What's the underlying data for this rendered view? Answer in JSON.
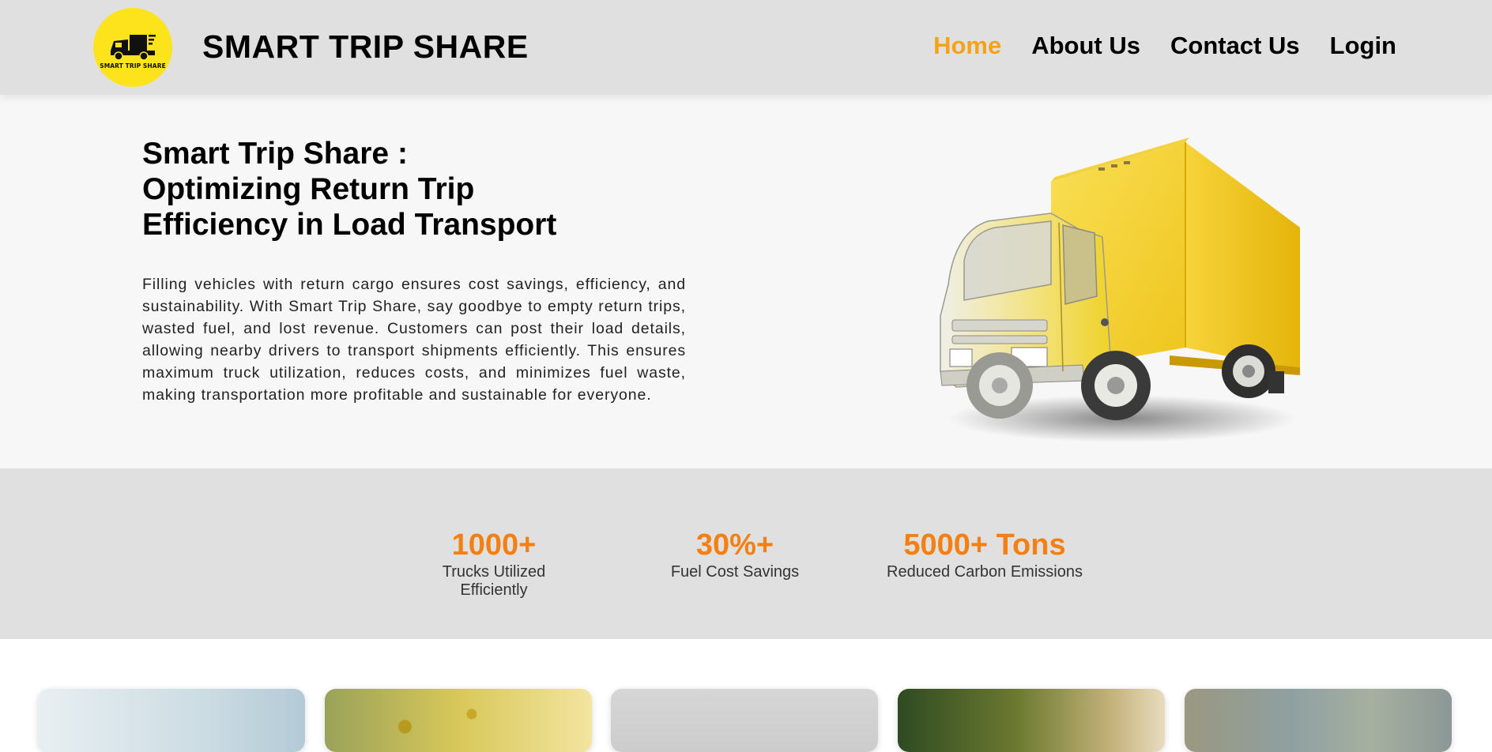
{
  "header": {
    "logo_text": "SMART TRIP SHARE",
    "brand": "SMART TRIP SHARE",
    "nav": [
      {
        "label": "Home",
        "active": true
      },
      {
        "label": "About Us",
        "active": false
      },
      {
        "label": "Contact Us",
        "active": false
      },
      {
        "label": "Login",
        "active": false
      }
    ]
  },
  "hero": {
    "title_lines": [
      "Smart Trip Share :",
      "Optimizing Return Trip",
      "Efficiency in Load Transport"
    ],
    "description": "Filling vehicles with return cargo ensures cost savings, efficiency, and sustainability. With Smart Trip Share, say goodbye to empty return trips, wasted fuel, and lost revenue. Customers can post their load details, allowing nearby drivers to transport shipments efficiently. This ensures maximum truck utilization, reduces costs, and minimizes fuel waste, making transportation more profitable and sustainable for everyone."
  },
  "stats": [
    {
      "value": "1000+",
      "label": "Trucks Utilized Efficiently"
    },
    {
      "value": "30%+",
      "label": "Fuel Cost Savings"
    },
    {
      "value": "5000+ Tons",
      "label": "Reduced Carbon Emissions"
    }
  ],
  "colors": {
    "accent": "#f47f12",
    "nav_active": "#f5a218",
    "logo_bg": "#fde31c",
    "header_bg": "#e0e0e0"
  }
}
